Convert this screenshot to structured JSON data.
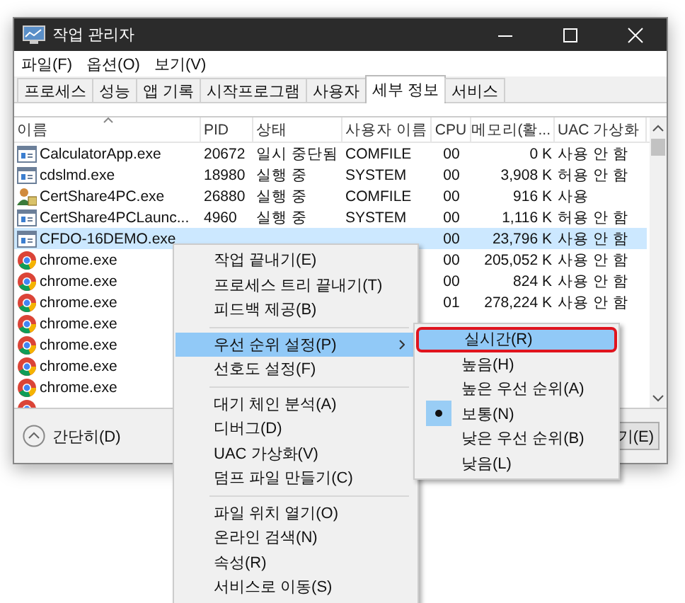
{
  "window": {
    "title": "작업 관리자"
  },
  "menu": [
    "파일(F)",
    "옵션(O)",
    "보기(V)"
  ],
  "tabs": [
    {
      "label": "프로세스",
      "selected": false
    },
    {
      "label": "성능",
      "selected": false
    },
    {
      "label": "앱 기록",
      "selected": false
    },
    {
      "label": "시작프로그램",
      "selected": false
    },
    {
      "label": "사용자",
      "selected": false
    },
    {
      "label": "세부 정보",
      "selected": true
    },
    {
      "label": "서비스",
      "selected": false
    }
  ],
  "table": {
    "columns": [
      {
        "label": "이름",
        "sorted": true
      },
      {
        "label": "PID",
        "sorted": false
      },
      {
        "label": "상태",
        "sorted": false
      },
      {
        "label": "사용자 이름",
        "sorted": false
      },
      {
        "label": "CPU",
        "sorted": false
      },
      {
        "label": "메모리(활...",
        "sorted": false
      },
      {
        "label": "UAC 가상화",
        "sorted": false
      }
    ],
    "rows": [
      {
        "kind": "app",
        "selected": false,
        "name": "CalculatorApp.exe",
        "pid": "20672",
        "status": "일시 중단됨",
        "user": "COMFILE",
        "cpu": "00",
        "memory": "0 K",
        "uac": "사용 안 함"
      },
      {
        "kind": "app",
        "selected": false,
        "name": "cdslmd.exe",
        "pid": "18980",
        "status": "실행 중",
        "user": "SYSTEM",
        "cpu": "00",
        "memory": "3,908 K",
        "uac": "허용 안 함"
      },
      {
        "kind": "cert",
        "selected": false,
        "name": "CertShare4PC.exe",
        "pid": "26880",
        "status": "실행 중",
        "user": "COMFILE",
        "cpu": "00",
        "memory": "916 K",
        "uac": "사용"
      },
      {
        "kind": "app",
        "selected": false,
        "name": "CertShare4PCLaunc...",
        "pid": "4960",
        "status": "실행 중",
        "user": "SYSTEM",
        "cpu": "00",
        "memory": "1,116 K",
        "uac": "허용 안 함"
      },
      {
        "kind": "app",
        "selected": true,
        "name": "CFDO-16DEMO.exe",
        "cpu": "00",
        "memory": "23,796 K",
        "uac": "사용 안 함"
      },
      {
        "kind": "chrome",
        "selected": false,
        "name": "chrome.exe",
        "cpu": "00",
        "memory": "205,052 K",
        "uac": "사용 안 함"
      },
      {
        "kind": "chrome",
        "selected": false,
        "name": "chrome.exe",
        "cpu": "00",
        "memory": "824 K",
        "uac": "사용 안 함"
      },
      {
        "kind": "chrome",
        "selected": false,
        "name": "chrome.exe",
        "cpu": "01",
        "memory": "278,224 K",
        "uac": "사용 안 함"
      },
      {
        "kind": "chrome",
        "selected": false,
        "name": "chrome.exe"
      },
      {
        "kind": "chrome",
        "selected": false,
        "name": "chrome.exe"
      },
      {
        "kind": "chrome",
        "selected": false,
        "name": "chrome.exe"
      },
      {
        "kind": "chrome",
        "selected": false,
        "name": "chrome.exe"
      },
      {
        "kind": "chrome",
        "selected": false
      }
    ]
  },
  "footer": {
    "toggle": "간단히(D)",
    "button": "기(E)"
  },
  "context_menu": [
    {
      "kind": "item",
      "label": "작업 끝내기(E)",
      "selected": false,
      "submenu": false
    },
    {
      "kind": "item",
      "label": "프로세스 트리 끝내기(T)",
      "selected": false,
      "submenu": false
    },
    {
      "kind": "item",
      "label": "피드백 제공(B)",
      "selected": false,
      "submenu": false
    },
    {
      "kind": "separator"
    },
    {
      "kind": "item",
      "label": "우선 순위 설정(P)",
      "selected": true,
      "submenu": true
    },
    {
      "kind": "item",
      "label": "선호도 설정(F)",
      "selected": false,
      "submenu": false
    },
    {
      "kind": "separator"
    },
    {
      "kind": "item",
      "label": "대기 체인 분석(A)",
      "selected": false,
      "submenu": false
    },
    {
      "kind": "item",
      "label": "디버그(D)",
      "selected": false,
      "submenu": false
    },
    {
      "kind": "item",
      "label": "UAC 가상화(V)",
      "selected": false,
      "submenu": false
    },
    {
      "kind": "item",
      "label": "덤프 파일 만들기(C)",
      "selected": false,
      "submenu": false
    },
    {
      "kind": "separator"
    },
    {
      "kind": "item",
      "label": "파일 위치 열기(O)",
      "selected": false,
      "submenu": false
    },
    {
      "kind": "item",
      "label": "온라인 검색(N)",
      "selected": false,
      "submenu": false
    },
    {
      "kind": "item",
      "label": "속성(R)",
      "selected": false,
      "submenu": false
    },
    {
      "kind": "item",
      "label": "서비스로 이동(S)",
      "selected": false,
      "submenu": false
    }
  ],
  "priority_submenu": [
    {
      "label": "실시간(R)",
      "selected": true,
      "checked": false,
      "outlined": true
    },
    {
      "label": "높음(H)",
      "selected": false,
      "checked": false,
      "outlined": false
    },
    {
      "label": "높은 우선 순위(A)",
      "selected": false,
      "checked": false,
      "outlined": false
    },
    {
      "label": "보통(N)",
      "selected": false,
      "checked": true,
      "outlined": false
    },
    {
      "label": "낮은 우선 순위(B)",
      "selected": false,
      "checked": false,
      "outlined": false
    },
    {
      "label": "낮음(L)",
      "selected": false,
      "checked": false,
      "outlined": false
    }
  ]
}
